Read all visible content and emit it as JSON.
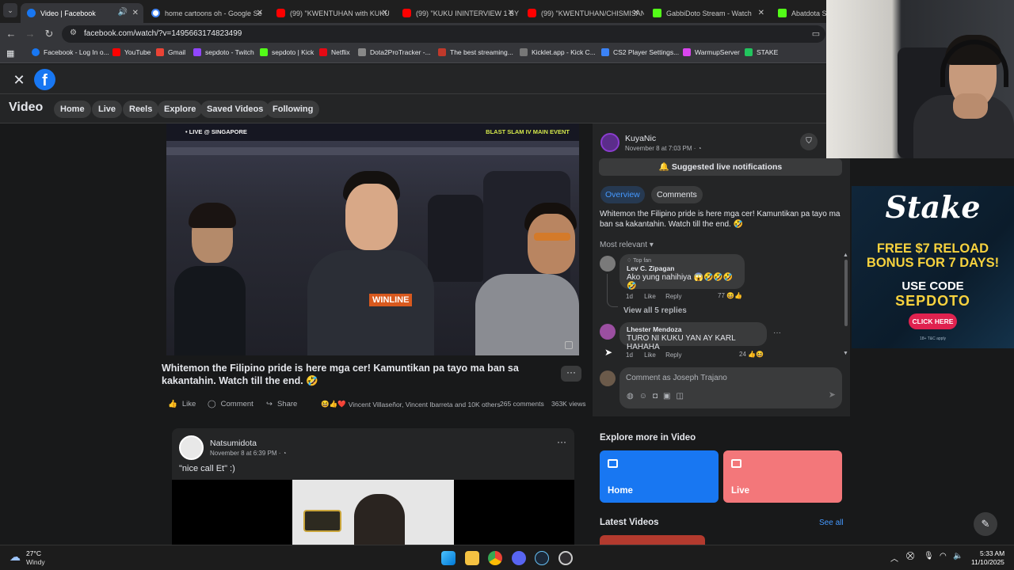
{
  "browser": {
    "tabs": [
      {
        "title": "Video | Facebook",
        "active": true,
        "color": "#1877f2"
      },
      {
        "title": "home cartoons oh - Google Se",
        "color": "#4285f4"
      },
      {
        "title": "(99) \"KWENTUHAN with KUKU",
        "color": "#ff0000"
      },
      {
        "title": "(99) \"KUKU ININTERVIEW 1 BY",
        "color": "#ff0000"
      },
      {
        "title": "(99) \"KWENTUHAN/CHISMISAN",
        "color": "#ff0000"
      },
      {
        "title": "GabbiDoto Stream - Watch",
        "color": "#53fc18"
      },
      {
        "title": "Abatdota Str",
        "color": "#53fc18"
      }
    ],
    "url": "facebook.com/watch/?v=1495663174823499",
    "bookmarks": [
      {
        "label": "Facebook - Log In o...",
        "color": "#1877f2"
      },
      {
        "label": "YouTube",
        "color": "#ff0000"
      },
      {
        "label": "Gmail",
        "color": "#ea4335"
      },
      {
        "label": "sepdoto - Twitch",
        "color": "#9146ff"
      },
      {
        "label": "sepdoto | Kick",
        "color": "#53fc18"
      },
      {
        "label": "Netflix",
        "color": "#e50914"
      },
      {
        "label": "Dota2ProTracker -...",
        "color": "#888888"
      },
      {
        "label": "The best streaming...",
        "color": "#c0392b"
      },
      {
        "label": "Kicklet.app - Kick C...",
        "color": "#777777"
      },
      {
        "label": "CS2 Player Settings...",
        "color": "#3b82f6"
      },
      {
        "label": "WarmupServer",
        "color": "#d946ef"
      },
      {
        "label": "STAKE",
        "color": "#22c55e"
      }
    ]
  },
  "fb": {
    "section_title": "Video",
    "nav": [
      "Home",
      "Live",
      "Reels",
      "Explore",
      "Saved Videos",
      "Following"
    ]
  },
  "video": {
    "overlay_left": "• LIVE @ SINGAPORE",
    "overlay_right": "BLAST SLAM IV MAIN EVENT",
    "shirt_text": "WINLINE",
    "caption": "Whitemon the Filipino pride is here mga cer! Kamuntikan pa tayo ma ban sa kakantahin. Watch till the end. 🤣",
    "actions": {
      "like": "Like",
      "comment": "Comment",
      "share": "Share"
    },
    "reactions_text": "Vincent Villaseñor, Vincent Ibarreta and 10K others",
    "comments_count": "265 comments",
    "views": "363K views"
  },
  "panel": {
    "author": "KuyaNic",
    "meta": "November 8 at 7:03 PM · ◔",
    "notify_btn": "Suggested live notifications",
    "tabs": [
      "Overview",
      "Comments"
    ],
    "description": "Whitemon the Filipino pride is here mga cer! Kamuntikan pa tayo ma ban sa kakantahin. Watch till the end. 🤣",
    "sort": "Most relevant",
    "comments": [
      {
        "badge": "Top fan",
        "name": "Lev C. Zipagan",
        "text": "Ako yung nahihiya 😱🤣🤣🤣🤣",
        "time": "1d",
        "like": "Like",
        "reply": "Reply",
        "count": "77"
      },
      {
        "name": "Lhester Mendoza",
        "text": "TURO NI KUKU YAN AY KARL HAHAHA",
        "time": "1d",
        "like": "Like",
        "reply": "Reply",
        "count": "24"
      }
    ],
    "view_replies": "View all 5 replies",
    "comment_placeholder": "Comment as Joseph Trajano"
  },
  "post2": {
    "author": "Natsumidota",
    "meta": "November 8 at 6:39 PM · ◔",
    "text": "\"nice call Et\" :)"
  },
  "explore": {
    "title": "Explore more in Video",
    "cards": [
      {
        "label": "Home",
        "color": "#1877f2"
      },
      {
        "label": "Live",
        "color": "#f3777a"
      }
    ],
    "latest": "Latest Videos",
    "see_all": "See all"
  },
  "ad": {
    "brand": "Stake",
    "headline": "FREE $7 RELOAD BONUS FOR 7 DAYS!",
    "code_label": "USE CODE",
    "code": "SEPDOTO",
    "cta": "CLICK HERE",
    "fine": "18+ T&C apply"
  },
  "taskbar": {
    "weather_temp": "27°C",
    "weather_desc": "Windy",
    "time": "5:33 AM",
    "date": "11/10/2025"
  }
}
